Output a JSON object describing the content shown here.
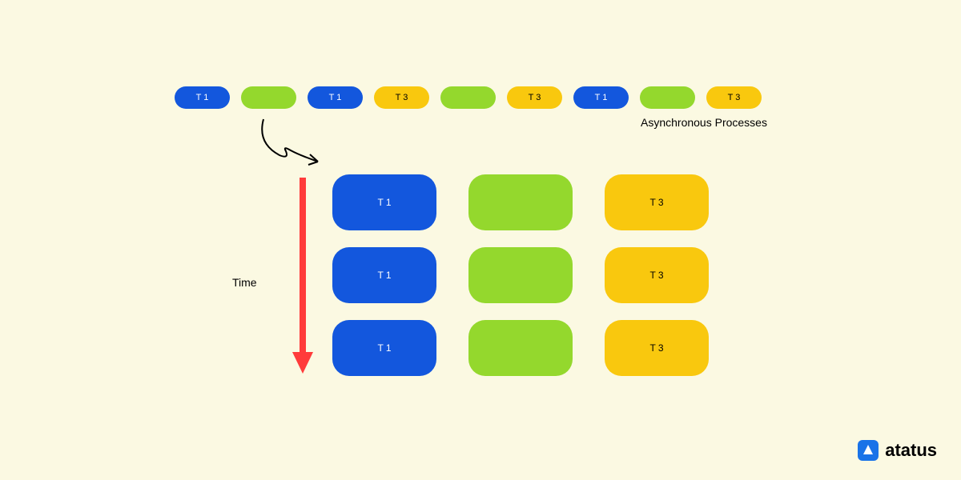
{
  "topRow": [
    {
      "label": "T 1",
      "color": "blue"
    },
    {
      "label": "",
      "color": "green"
    },
    {
      "label": "T 1",
      "color": "blue"
    },
    {
      "label": "T 3",
      "color": "yellow"
    },
    {
      "label": "",
      "color": "green"
    },
    {
      "label": "T 3",
      "color": "yellow"
    },
    {
      "label": "T 1",
      "color": "blue"
    },
    {
      "label": "",
      "color": "green"
    },
    {
      "label": "T 3",
      "color": "yellow"
    }
  ],
  "caption": "Asynchronous Processes",
  "timeLabel": "Time",
  "grid": [
    [
      {
        "label": "T 1",
        "color": "blue"
      },
      {
        "label": "",
        "color": "green"
      },
      {
        "label": "T 3",
        "color": "yellow"
      }
    ],
    [
      {
        "label": "T 1",
        "color": "blue"
      },
      {
        "label": "",
        "color": "green"
      },
      {
        "label": "T 3",
        "color": "yellow"
      }
    ],
    [
      {
        "label": "T 1",
        "color": "blue"
      },
      {
        "label": "",
        "color": "green"
      },
      {
        "label": "T 3",
        "color": "yellow"
      }
    ]
  ],
  "brand": "atatus"
}
